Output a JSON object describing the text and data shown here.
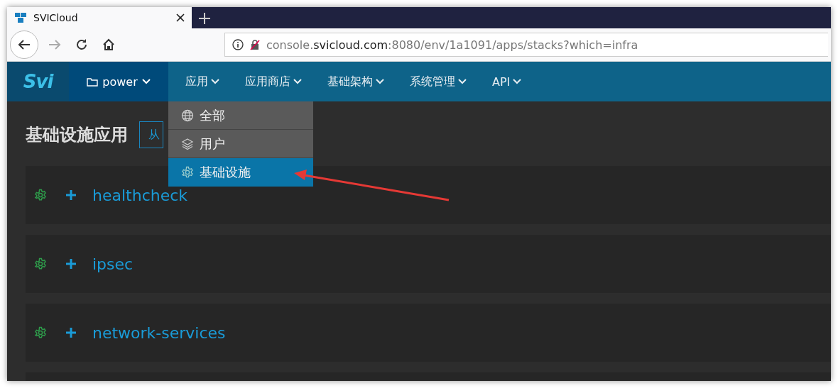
{
  "browser": {
    "tab_title": "SVICloud",
    "url": "console.**svicloud.com**:8080/env/1a1091/apps/stacks?which=infra"
  },
  "nav": {
    "logo": "Svi",
    "environment": "power",
    "items": [
      {
        "label": "应用",
        "open": true
      },
      {
        "label": "应用商店",
        "open": false
      },
      {
        "label": "基础架构",
        "open": false
      },
      {
        "label": "系统管理",
        "open": false
      },
      {
        "label": "API",
        "open": false
      }
    ],
    "dropdown": [
      {
        "kind": "all",
        "label": "全部",
        "selected": false
      },
      {
        "kind": "user",
        "label": "用户",
        "selected": false
      },
      {
        "kind": "infra",
        "label": "基础设施",
        "selected": true
      }
    ]
  },
  "page": {
    "title": "基础设施应用",
    "add_button": "从",
    "stacks": [
      {
        "name": "healthcheck"
      },
      {
        "name": "ipsec"
      },
      {
        "name": "network-services"
      }
    ]
  }
}
